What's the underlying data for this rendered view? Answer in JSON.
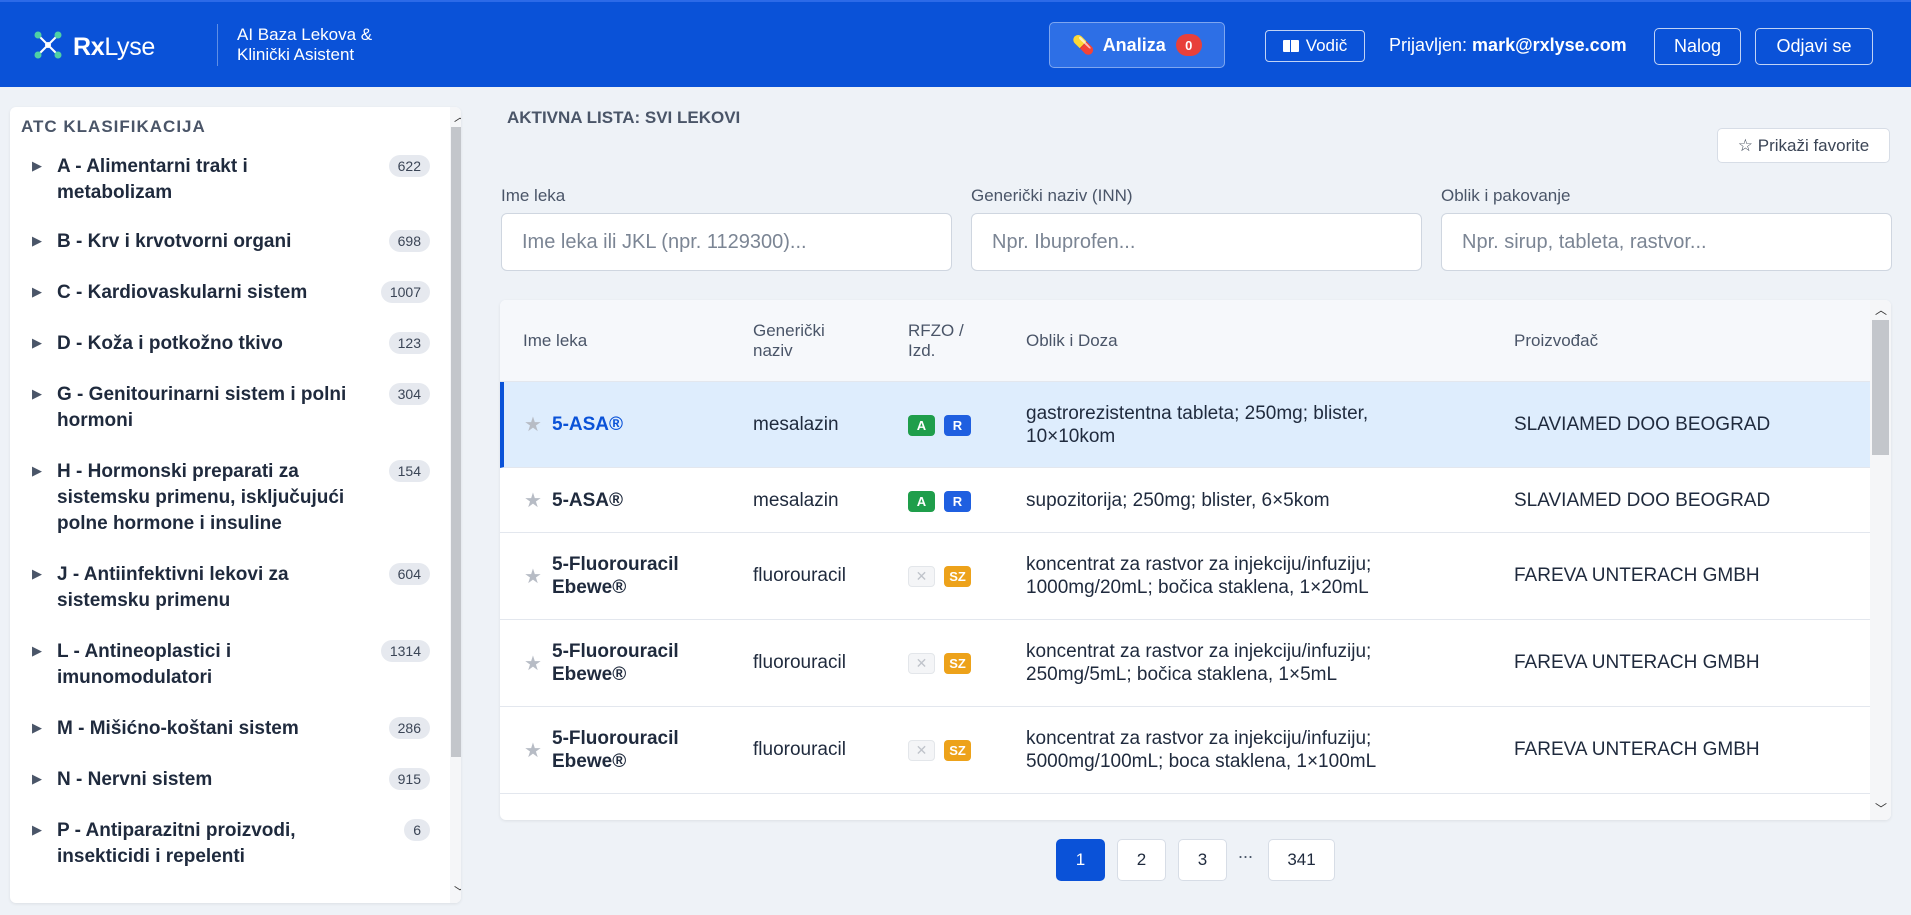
{
  "header": {
    "logo_bold": "Rx",
    "logo_rest": "Lyse",
    "subtitle_line1": "AI Baza Lekova &",
    "subtitle_line2": "Klinički Asistent",
    "analiza_label": "Analiza",
    "analiza_count": "0",
    "vodic_label": "Vodič",
    "user_prefix": "Prijavljen:",
    "user_email": "mark@rxlyse.com",
    "nalog_label": "Nalog",
    "odjavi_label": "Odjavi se"
  },
  "sidebar": {
    "title": "ATC KLASIFIKACIJA",
    "items": [
      {
        "label": "A - Alimentarni trakt i metabolizam",
        "count": "622"
      },
      {
        "label": "B - Krv i krvotvorni organi",
        "count": "698"
      },
      {
        "label": "C - Kardiovaskularni sistem",
        "count": "1007"
      },
      {
        "label": "D - Koža i potkožno tkivo",
        "count": "123"
      },
      {
        "label": "G - Genitourinarni sistem i polni hormoni",
        "count": "304"
      },
      {
        "label": "H - Hormonski preparati za sistemsku primenu, isključujući polne hormone i insuline",
        "count": "154"
      },
      {
        "label": "J - Antiinfektivni lekovi za sistemsku primenu",
        "count": "604"
      },
      {
        "label": "L - Antineoplastici i imunomodulatori",
        "count": "1314"
      },
      {
        "label": "M - Mišićno-koštani sistem",
        "count": "286"
      },
      {
        "label": "N - Nervni sistem",
        "count": "915"
      },
      {
        "label": "P - Antiparazitni proizvodi, insekticidi i repelenti",
        "count": "6"
      }
    ]
  },
  "main": {
    "active_list": "AKTIVNA LISTA: SVI LEKOVI",
    "favorites_label": "☆ Prikaži favorite",
    "filters": {
      "name_label": "Ime leka",
      "name_placeholder": "Ime leka ili JKL (npr. 1129300)...",
      "inn_label": "Generički naziv (INN)",
      "inn_placeholder": "Npr. Ibuprofen...",
      "form_label": "Oblik i pakovanje",
      "form_placeholder": "Npr. sirup, tableta, rastvor..."
    },
    "table": {
      "headers": {
        "name": "Ime leka",
        "generic_line1": "Generički",
        "generic_line2": "naziv",
        "rfzo_line1": "RFZO /",
        "rfzo_line2": "Izd.",
        "form": "Oblik i Doza",
        "maker": "Proizvođač"
      },
      "rows": [
        {
          "name": "5-ASA®",
          "generic": "mesalazin",
          "rfzo": "A",
          "izd": "R",
          "form_line1": "gastrorezistentna tableta; 250mg; blister,",
          "form_line2": "10×10kom",
          "maker": "SLAVIAMED DOO BEOGRAD"
        },
        {
          "name": "5-ASA®",
          "generic": "mesalazin",
          "rfzo": "A",
          "izd": "R",
          "form_line1": "supozitorija; 250mg; blister, 6×5kom",
          "form_line2": "",
          "maker": "SLAVIAMED DOO BEOGRAD"
        },
        {
          "name_line1": "5-Fluorouracil",
          "name_line2": "Ebewe®",
          "generic": "fluorouracil",
          "rfzo": "✕",
          "izd": "SZ",
          "form_line1": "koncentrat za rastvor za injekciju/infuziju;",
          "form_line2": "1000mg/20mL; bočica staklena, 1×20mL",
          "maker": "FAREVA UNTERACH GMBH"
        },
        {
          "name_line1": "5-Fluorouracil",
          "name_line2": "Ebewe®",
          "generic": "fluorouracil",
          "rfzo": "✕",
          "izd": "SZ",
          "form_line1": "koncentrat za rastvor za injekciju/infuziju;",
          "form_line2": "250mg/5mL; bočica staklena, 1×5mL",
          "maker": "FAREVA UNTERACH GMBH"
        },
        {
          "name_line1": "5-Fluorouracil",
          "name_line2": "Ebewe®",
          "generic": "fluorouracil",
          "rfzo": "✕",
          "izd": "SZ",
          "form_line1": "koncentrat za rastvor za injekciju/infuziju;",
          "form_line2": "5000mg/100mL; boca staklena, 1×100mL",
          "maker": "FAREVA UNTERACH GMBH"
        }
      ]
    },
    "pagination": {
      "pages": [
        "1",
        "2",
        "3",
        "341"
      ],
      "ellipsis": "...",
      "current": "1"
    }
  },
  "icons": {
    "logo": "molecule-network-icon",
    "analiza": "pill-icon",
    "vodic": "book-icon",
    "star": "star-icon",
    "arrow": "caret-right-icon"
  },
  "colors": {
    "brand": "#0a52d8",
    "selected_row": "#deedfd",
    "tag_a": "#1f9e4b",
    "tag_r": "#1f5fe0",
    "tag_sz": "#eda21a",
    "badge": "#e8403a"
  }
}
